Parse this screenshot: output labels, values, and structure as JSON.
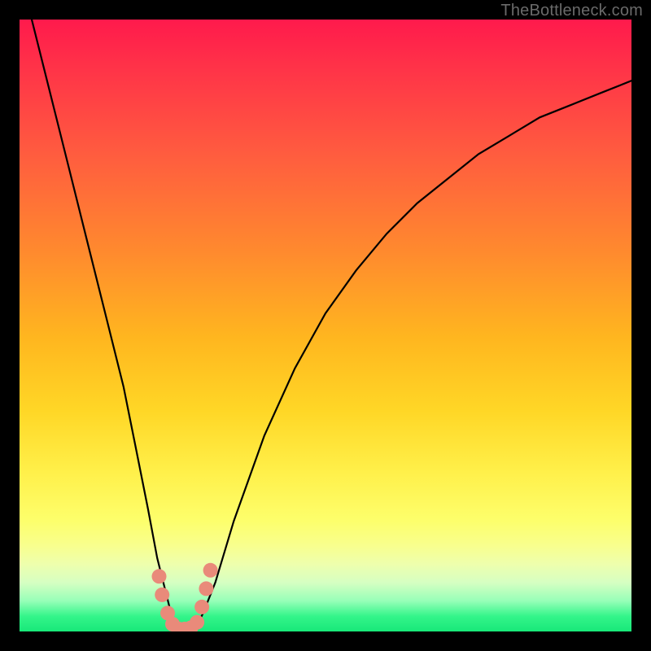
{
  "watermark": "TheBottleneck.com",
  "chart_data": {
    "type": "line",
    "title": "",
    "xlabel": "",
    "ylabel": "",
    "xlim": [
      0,
      100
    ],
    "ylim": [
      0,
      100
    ],
    "series": [
      {
        "name": "bottleneck-curve",
        "x": [
          2,
          5,
          8,
          11,
          14,
          17,
          19,
          21,
          22.5,
          24,
          25,
          26,
          27,
          28,
          29,
          30,
          32,
          35,
          40,
          45,
          50,
          55,
          60,
          65,
          70,
          75,
          80,
          85,
          90,
          95,
          100
        ],
        "y_pct": [
          100,
          88,
          76,
          64,
          52,
          40,
          30,
          20,
          12,
          6,
          2,
          0,
          0,
          0,
          1,
          3,
          8,
          18,
          32,
          43,
          52,
          59,
          65,
          70,
          74,
          78,
          81,
          84,
          86,
          88,
          90
        ]
      }
    ],
    "markers": {
      "name": "highlight-dots",
      "color": "#e98a7a",
      "points": [
        {
          "x": 22.8,
          "y_pct": 9
        },
        {
          "x": 23.3,
          "y_pct": 6
        },
        {
          "x": 24.2,
          "y_pct": 3
        },
        {
          "x": 25.0,
          "y_pct": 1.2
        },
        {
          "x": 26.0,
          "y_pct": 0.4
        },
        {
          "x": 27.0,
          "y_pct": 0.4
        },
        {
          "x": 28.0,
          "y_pct": 0.6
        },
        {
          "x": 29.0,
          "y_pct": 1.5
        },
        {
          "x": 29.8,
          "y_pct": 4
        },
        {
          "x": 30.5,
          "y_pct": 7
        },
        {
          "x": 31.2,
          "y_pct": 10
        }
      ]
    }
  }
}
